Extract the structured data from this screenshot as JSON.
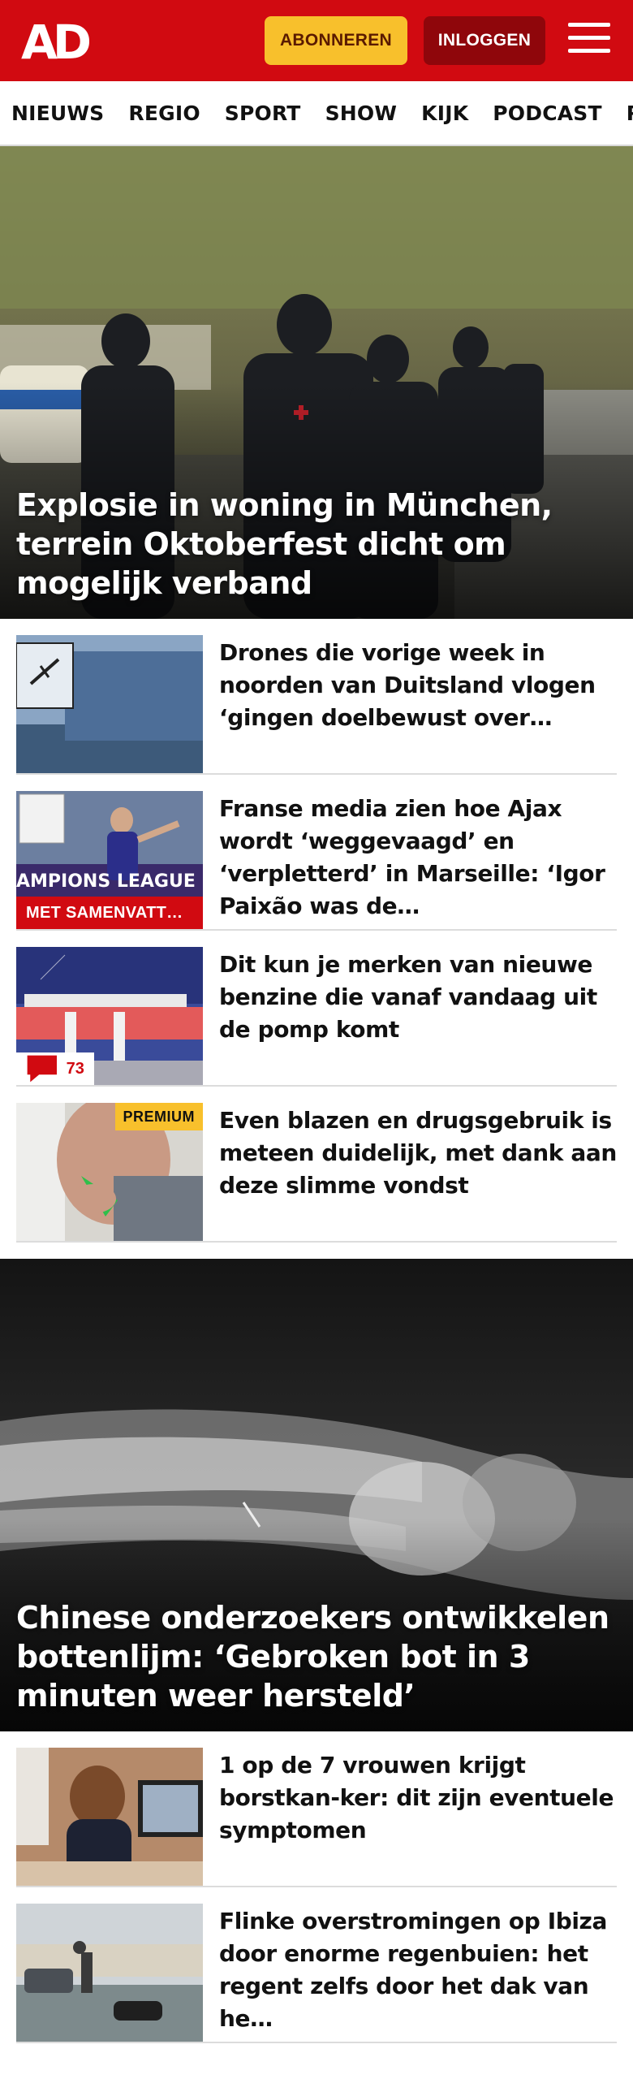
{
  "header": {
    "logo_text": "AD",
    "subscribe_label": "ABONNEREN",
    "login_label": "INLOGGEN",
    "menu_icon": "hamburger-menu-icon",
    "colors": {
      "brand_red": "#d10a11",
      "subscribe_yellow": "#f8c02c",
      "login_dark_red": "#8f060b"
    }
  },
  "nav": {
    "items": [
      "NIEUWS",
      "REGIO",
      "SPORT",
      "SHOW",
      "KIJK",
      "PODCAST",
      "PUZZ"
    ]
  },
  "hero1": {
    "title": "Explosie in woning in München, terrein Oktoberfest dicht om mogelijk verband"
  },
  "articles1": [
    {
      "title": "Drones die vorige week in noorden van Duitsland vlogen ‘gingen doelbewust over…"
    },
    {
      "title": "Franse media zien hoe Ajax wordt ‘weggevaagd’ en ‘verpletterd’ in Marseille: ‘Igor Paixão was de…",
      "badge": "MET SAMENVATT…"
    },
    {
      "title": "Dit kun je merken van nieuwe benzine die vanaf vandaag uit de pomp komt",
      "comments": "73",
      "comments_icon": "comment-icon"
    },
    {
      "title": "Even blazen en drugsgebruik is meteen duidelijk, met dank aan deze slimme vondst",
      "premium": "PREMIUM"
    }
  ],
  "hero2": {
    "title": "Chinese onderzoekers ontwikkelen bottenlijm: ‘Gebroken bot in 3 minuten weer hersteld’"
  },
  "articles2": [
    {
      "title": "1 op de 7 vrouwen krijgt borstkan-ker: dit zijn eventuele symptomen"
    },
    {
      "title": "Flinke overstromingen op Ibiza door enorme regenbuien: het regent zelfs door het dak van he…"
    }
  ]
}
